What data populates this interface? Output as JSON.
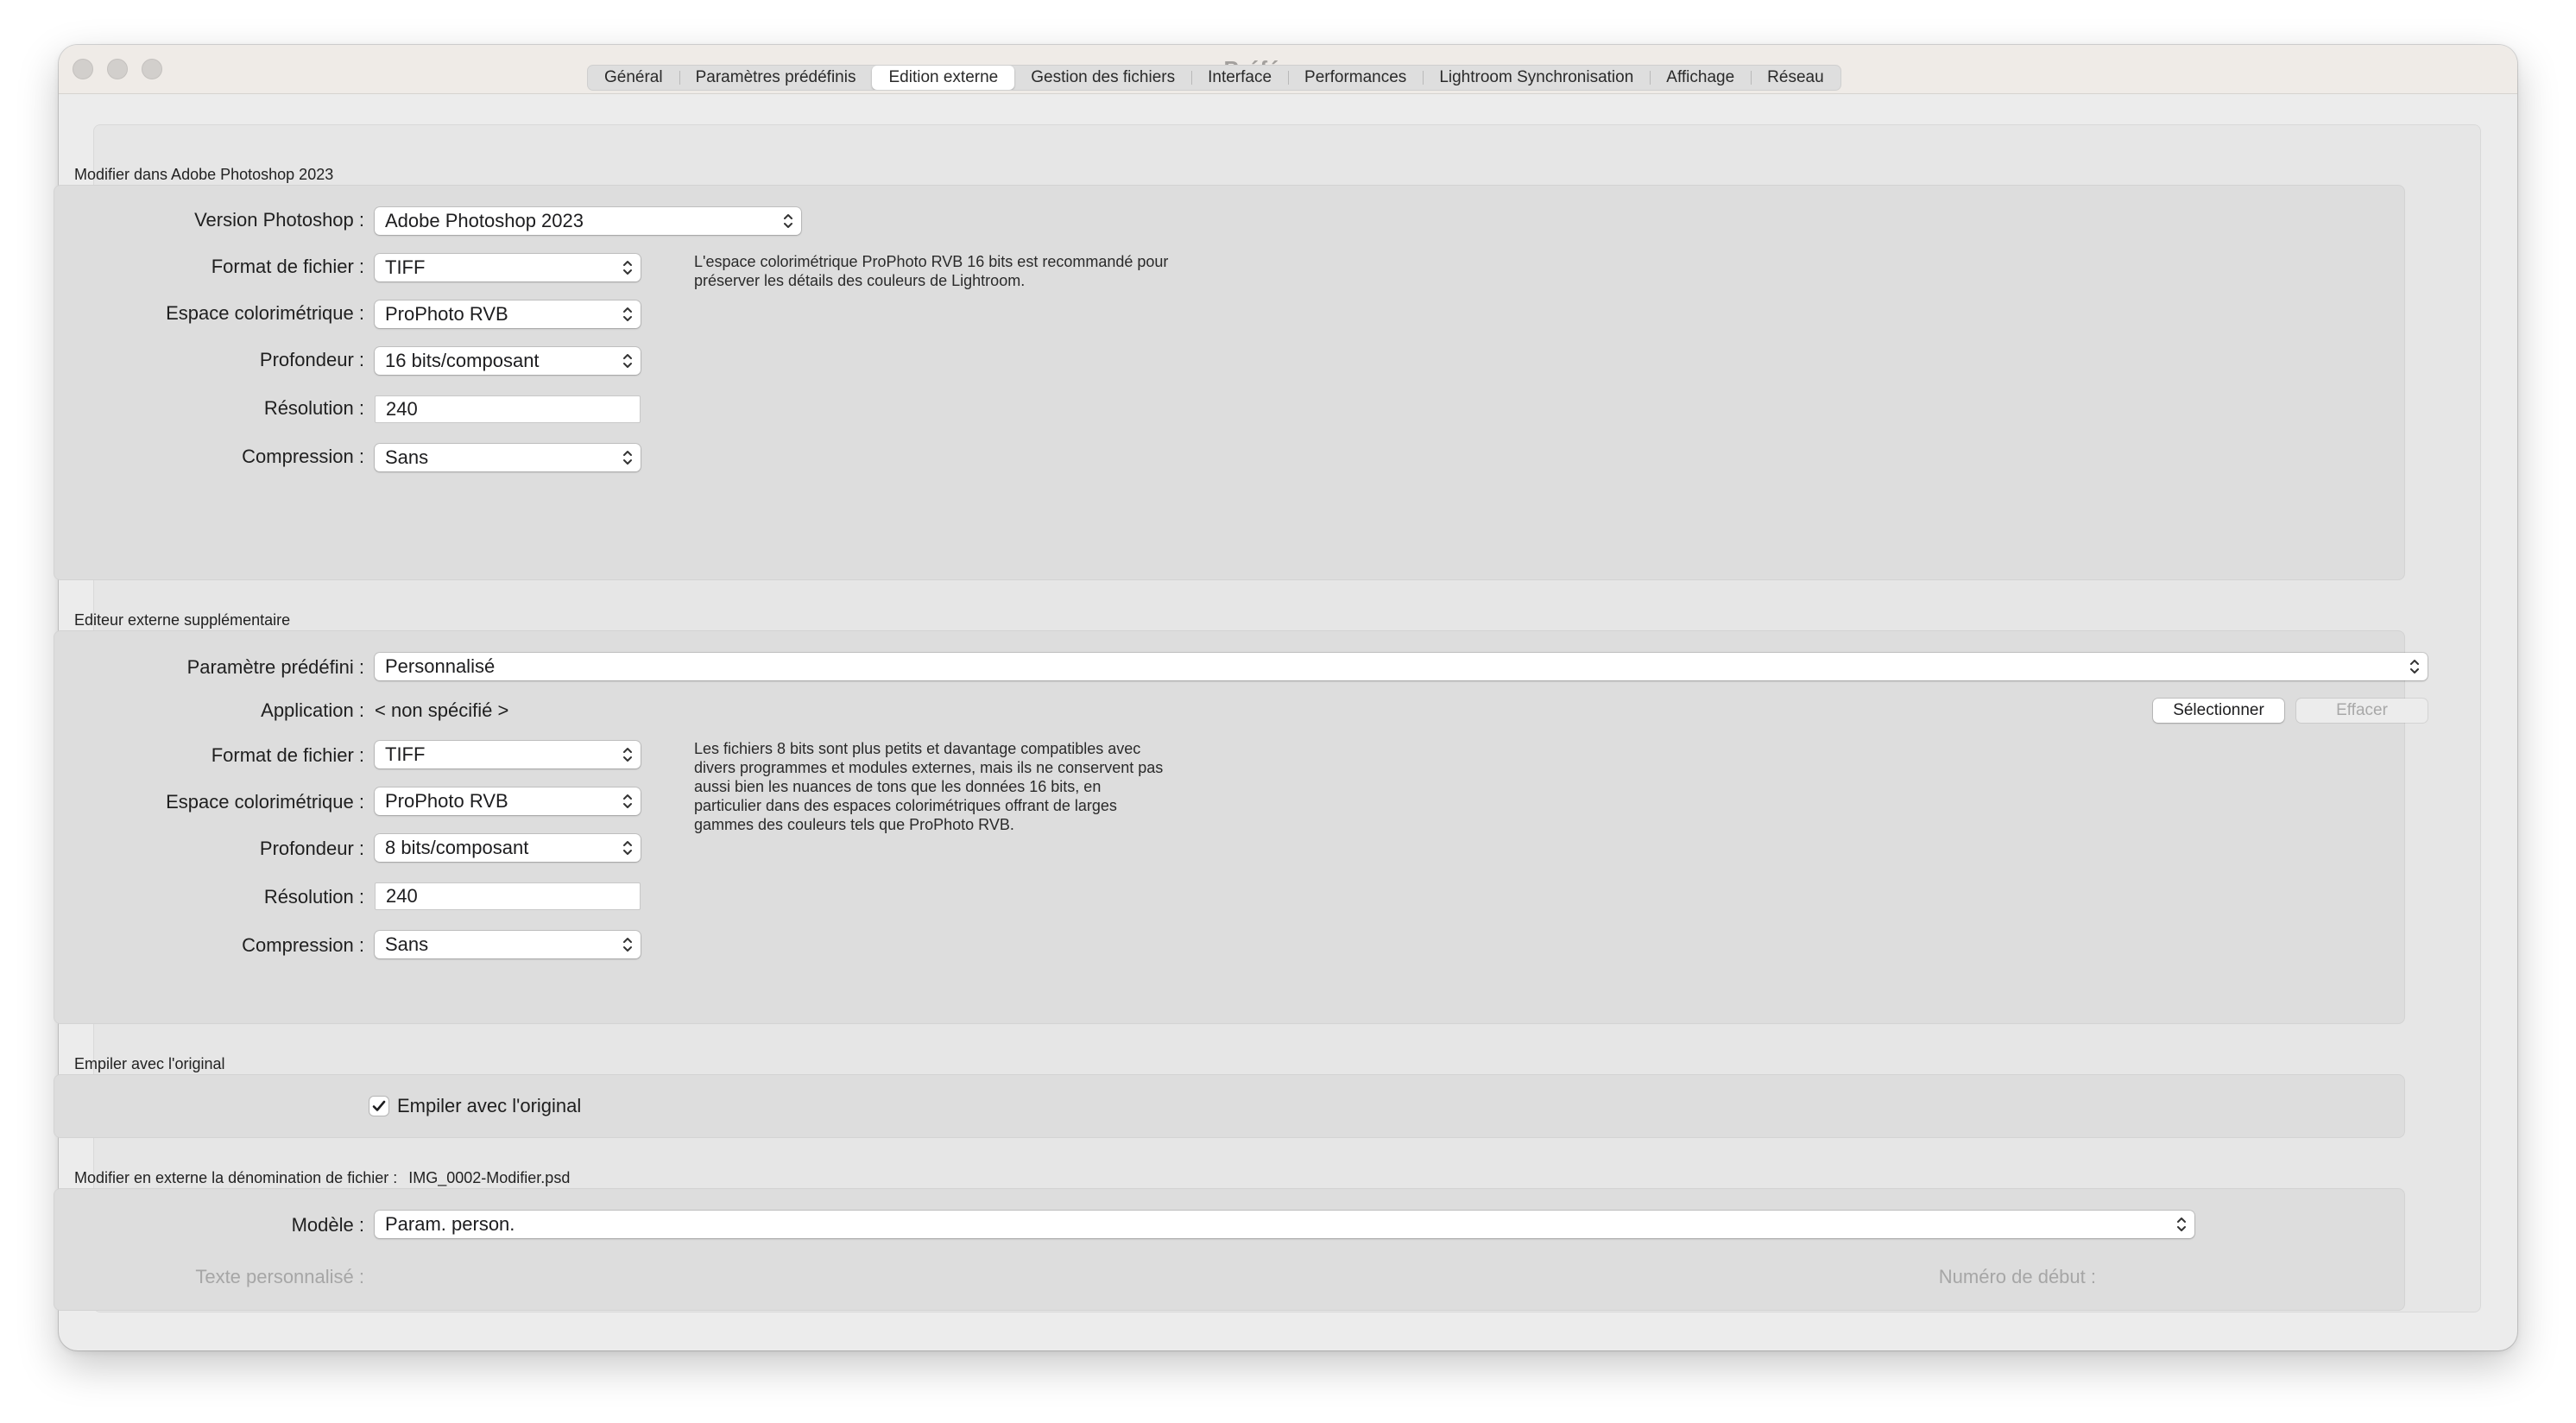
{
  "window": {
    "title": "Préférences"
  },
  "tabs": [
    {
      "label": "Général"
    },
    {
      "label": "Paramètres prédéfinis"
    },
    {
      "label": "Edition externe",
      "active": true
    },
    {
      "label": "Gestion des fichiers"
    },
    {
      "label": "Interface"
    },
    {
      "label": "Performances"
    },
    {
      "label": "Lightroom Synchronisation"
    },
    {
      "label": "Affichage"
    },
    {
      "label": "Réseau"
    }
  ],
  "photoshop": {
    "section_title": "Modifier dans Adobe Photoshop 2023",
    "version_label": "Version Photoshop :",
    "version_value": "Adobe Photoshop 2023",
    "format_label": "Format de fichier :",
    "format_value": "TIFF",
    "colorspace_label": "Espace colorimétrique :",
    "colorspace_value": "ProPhoto RVB",
    "depth_label": "Profondeur :",
    "depth_value": "16 bits/composant",
    "resolution_label": "Résolution :",
    "resolution_value": "240",
    "compression_label": "Compression :",
    "compression_value": "Sans",
    "note_line1": "L'espace colorimétrique ProPhoto RVB 16 bits est recommandé pour",
    "note_line2": "préserver les détails des couleurs de Lightroom."
  },
  "additional": {
    "section_title": "Editeur externe supplémentaire",
    "preset_label": "Paramètre prédéfini :",
    "preset_value": "Personnalisé",
    "application_label": "Application :",
    "application_value": "< non spécifié >",
    "select_button": "Sélectionner",
    "clear_button": "Effacer",
    "format_label": "Format de fichier :",
    "format_value": "TIFF",
    "colorspace_label": "Espace colorimétrique :",
    "colorspace_value": "ProPhoto RVB",
    "depth_label": "Profondeur :",
    "depth_value": "8 bits/composant",
    "resolution_label": "Résolution :",
    "resolution_value": "240",
    "compression_label": "Compression :",
    "compression_value": "Sans",
    "note_lines": [
      "Les fichiers 8 bits sont plus petits et davantage compatibles avec",
      "divers programmes et modules externes, mais ils ne conservent pas",
      "aussi bien les nuances de tons que les données 16 bits, en",
      "particulier dans des espaces colorimétriques offrant de larges",
      "gammes des couleurs tels que ProPhoto RVB."
    ]
  },
  "stack": {
    "section_title": "Empiler avec l'original",
    "checkbox_label": "Empiler avec l'original",
    "checked": true
  },
  "naming": {
    "section_title": "Modifier en externe la dénomination de fichier :",
    "example_filename": "IMG_0002-Modifier.psd",
    "template_label": "Modèle :",
    "template_value": "Param. person.",
    "custom_text_label": "Texte personnalisé :",
    "start_number_label": "Numéro de début :"
  }
}
